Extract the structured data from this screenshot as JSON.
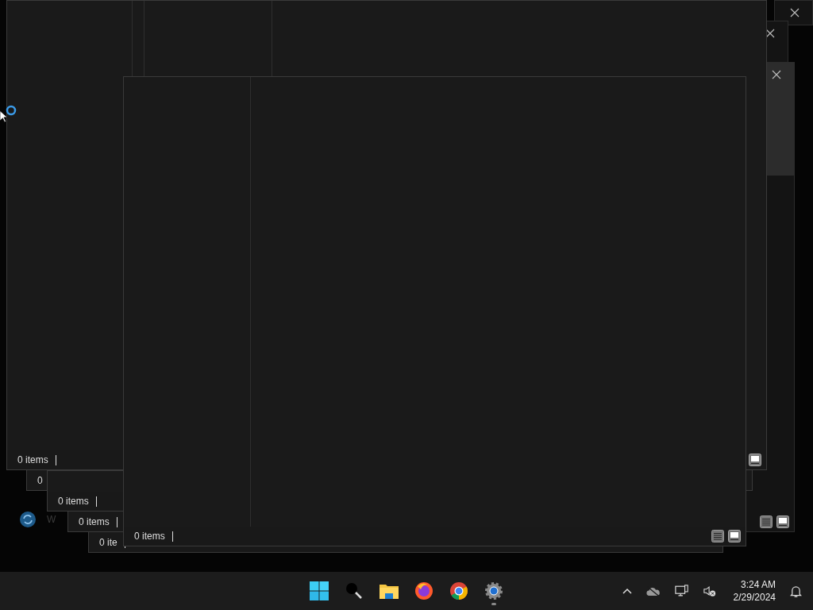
{
  "windows": [
    {
      "kind": "frame"
    },
    {
      "kind": "frame"
    },
    {
      "kind": "frame"
    },
    {
      "kind": "explorer",
      "status": "0"
    },
    {
      "kind": "explorer",
      "status": "0 items"
    },
    {
      "kind": "explorer",
      "status": "0 items"
    },
    {
      "kind": "explorer",
      "status": "0 ite"
    },
    {
      "kind": "explorer",
      "status": "0 items"
    },
    {
      "kind": "explorer",
      "status": "0 items"
    }
  ],
  "desktop_icon": {
    "label": "W"
  },
  "taskbar": {
    "apps": [
      {
        "kind": "start",
        "running": false
      },
      {
        "kind": "search",
        "running": false
      },
      {
        "kind": "folder",
        "running": false
      },
      {
        "kind": "firefox",
        "running": false
      },
      {
        "kind": "chrome",
        "running": false
      },
      {
        "kind": "settings",
        "running": true
      }
    ],
    "time": "3:24 AM",
    "date": "2/29/2024"
  }
}
